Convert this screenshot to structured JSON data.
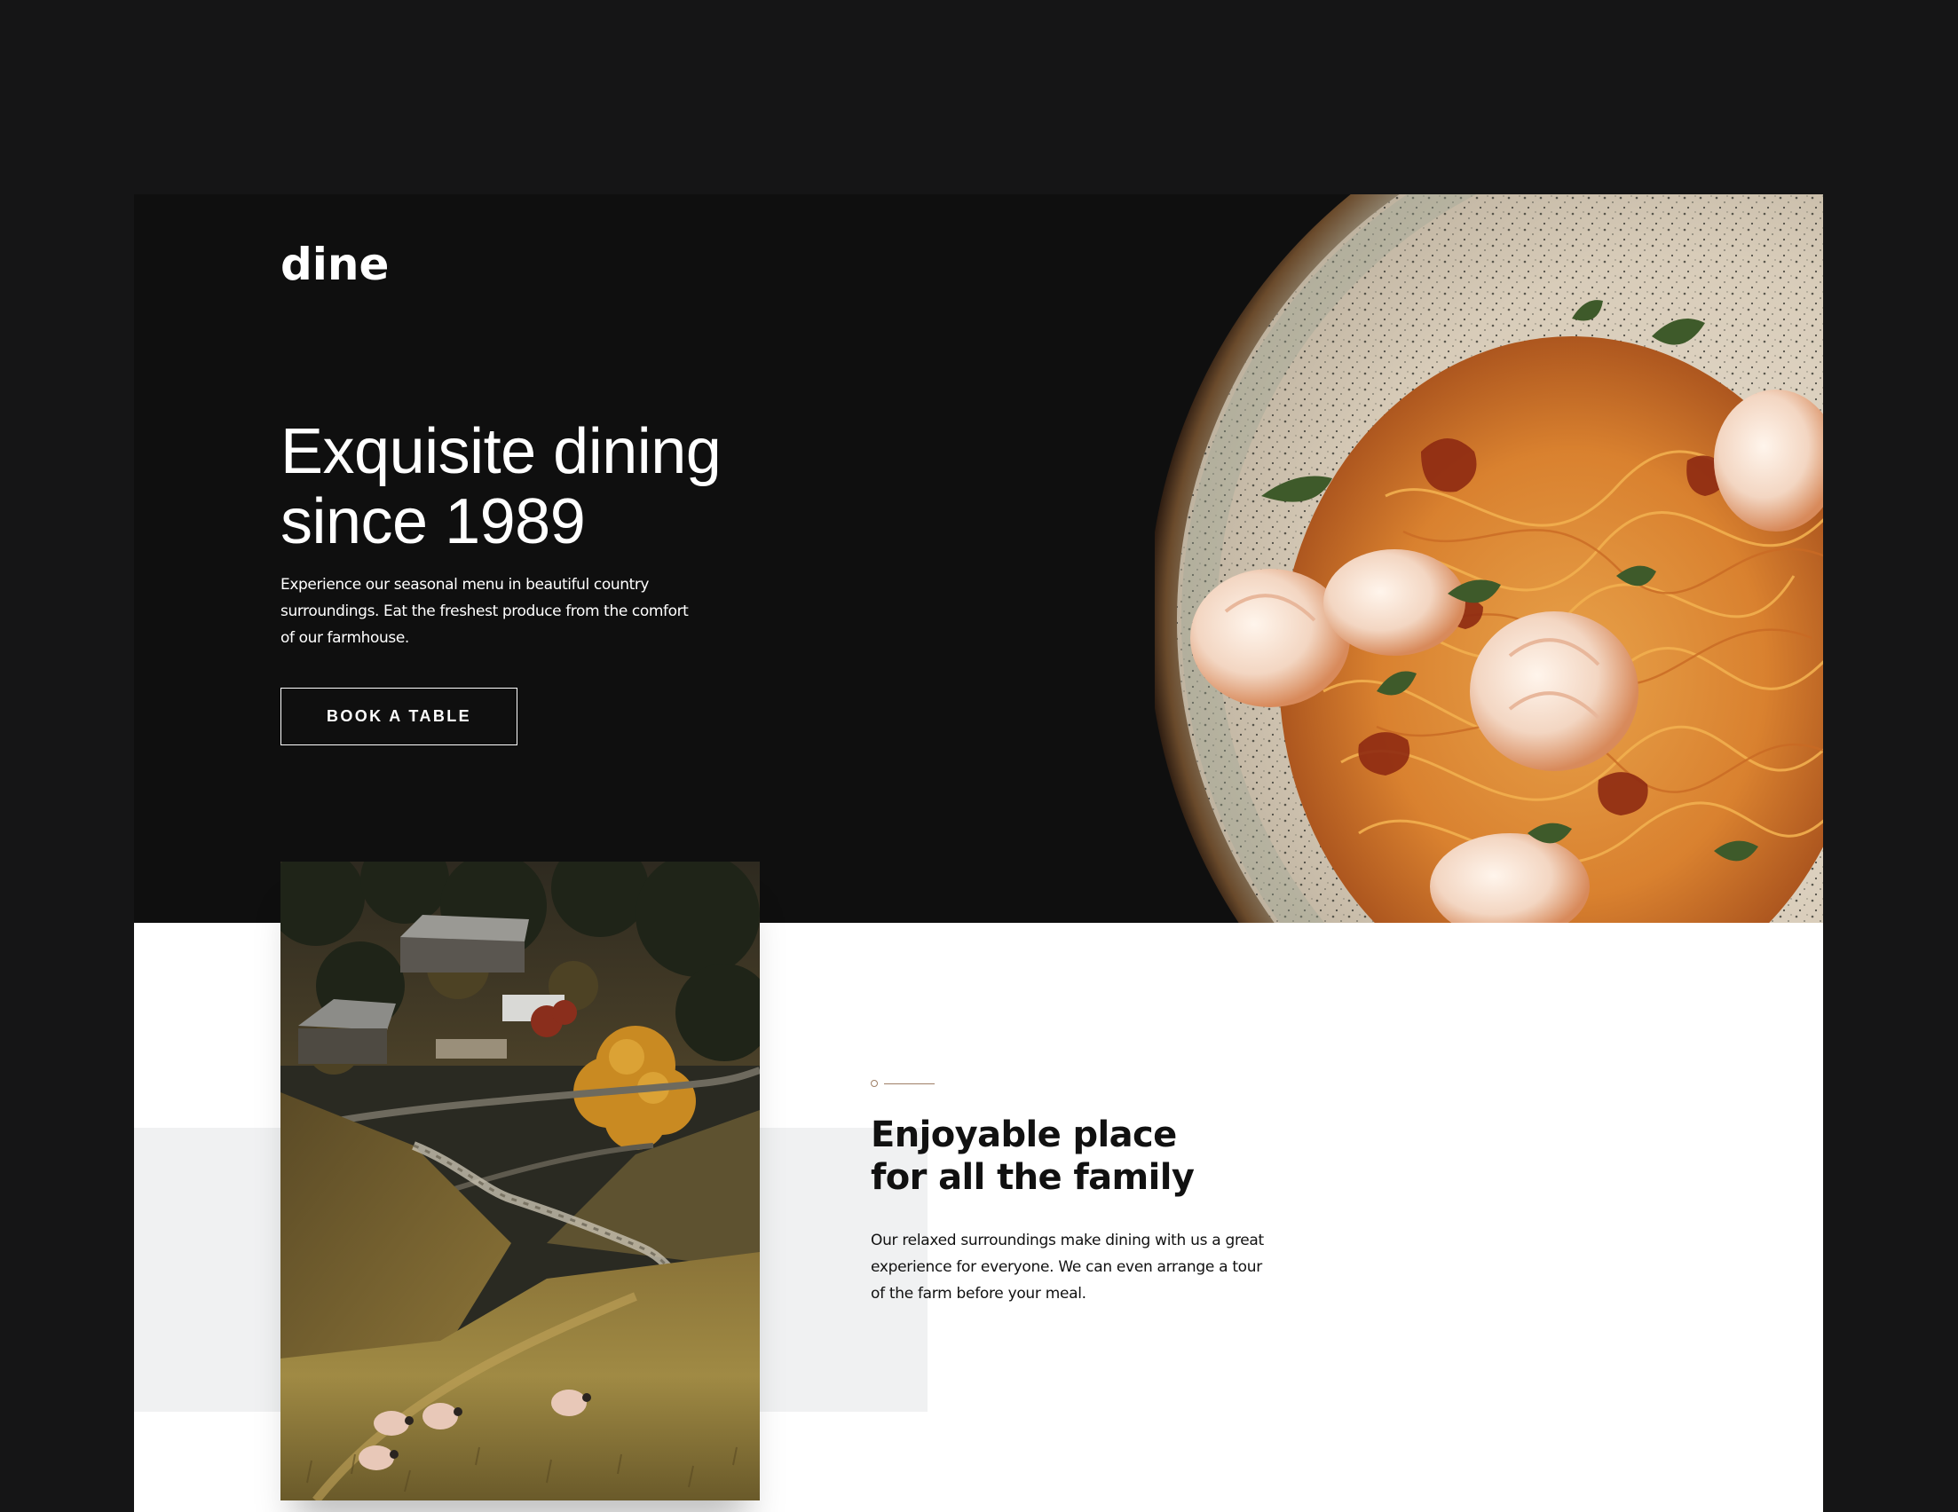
{
  "brand": {
    "logo": "dine"
  },
  "hero": {
    "title_line1": "Exquisite dining",
    "title_line2": "since 1989",
    "text": "Experience our seasonal menu in beautiful country surroundings. Eat the freshest produce from the comfort of our farmhouse.",
    "button_label": "BOOK A TABLE",
    "image": "pasta-plate-photo"
  },
  "about": {
    "image": "farm-valley-photo",
    "title_line1": "Enjoyable place",
    "title_line2": "for all the family",
    "text": "Our relaxed surroundings make dining with us a great experience for everyone. We can even arrange a tour of the farm before your meal."
  },
  "colors": {
    "page_background": "#151516",
    "hero_background": "#0f0f0f",
    "accent_beaver": "#9e7f66",
    "section_background": "#ffffff",
    "band_gray": "#f0f1f2",
    "text_dark": "#111111",
    "text_light": "#ffffff"
  }
}
